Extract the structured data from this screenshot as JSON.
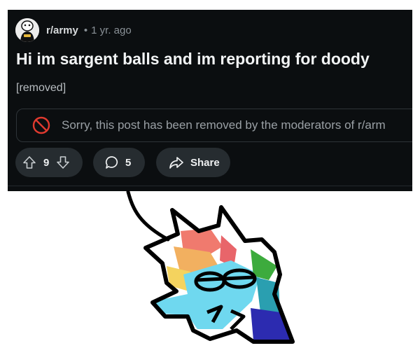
{
  "post": {
    "subreddit": "r/army",
    "separator": "•",
    "age": "1 yr. ago",
    "title": "Hi im sargent balls and im reporting for doody",
    "body": "[removed]",
    "removal_notice": "Sorry, this post has been removed by the moderators of r/arm",
    "actions": {
      "vote_count": "9",
      "comment_count": "5",
      "share_label": "Share"
    }
  },
  "icons": {
    "avatar": "subreddit-avatar",
    "removed": "prohibited-icon",
    "upvote": "upvote-arrow-icon",
    "downvote": "downvote-arrow-icon",
    "comment": "comment-bubble-icon",
    "share": "share-arrow-icon"
  },
  "colors": {
    "card_bg": "#0b0e10",
    "button_bg": "#262c30",
    "removed_red": "#e03a2f"
  }
}
